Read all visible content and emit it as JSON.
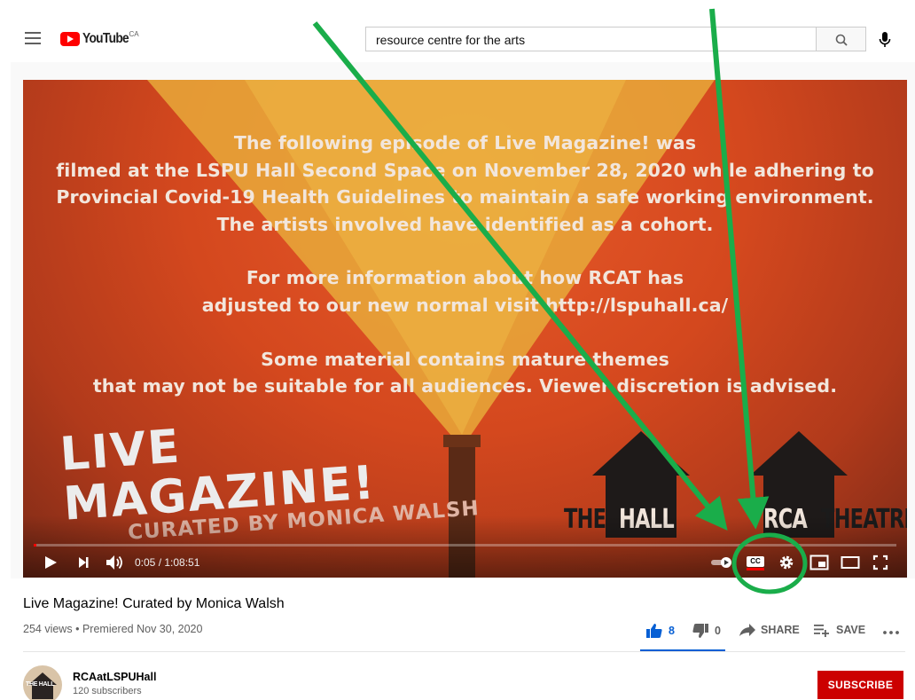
{
  "header": {
    "logo_text": "YouTube",
    "logo_region": "CA",
    "search_value": "resource centre for the arts"
  },
  "video": {
    "overlay_lines": [
      "The following episode of Live Magazine! was",
      "filmed at the LSPU Hall Second Space on November 28, 2020 while adhering to",
      "Provincial Covid-19 Health Guidelines to maintain a safe working environment.",
      "The artists involved have identified as a cohort.",
      "For more information about how RCAT has",
      "adjusted to our new normal visit http://lspuhall.ca/",
      "Some material contains mature themes",
      "that may not be suitable for all audiences. Viewer discretion is advised."
    ],
    "live_line1": "LIVE",
    "live_line2": "MAGAZINE!",
    "curated_line": "CURATED BY MONICA WALSH",
    "brand_the_1": "THE",
    "brand_hall": "HALL",
    "brand_rca": "RCA",
    "brand_theatre": "THEATRE",
    "time_display": "0:05 / 1:08:51",
    "progress_fraction": 0.0012,
    "cc_label": "CC"
  },
  "info": {
    "title": "Live Magazine! Curated by Monica Walsh",
    "views": "254 views",
    "separator": "•",
    "premiered": "Premiered Nov 30, 2020",
    "likes": "8",
    "dislikes": "0",
    "share_label": "SHARE",
    "save_label": "SAVE"
  },
  "channel": {
    "name": "RCAatLSPUHall",
    "subscribers": "120 subscribers",
    "avatar_text": "THE HALL",
    "subscribe_label": "SUBSCRIBE"
  },
  "colors": {
    "accent_red": "#cc0000",
    "like_blue": "#065fd4",
    "annotation_green": "#1aad4a"
  }
}
